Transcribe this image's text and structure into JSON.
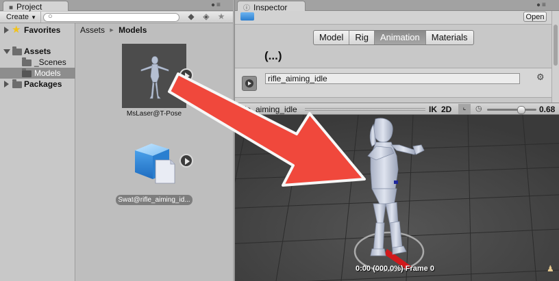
{
  "project": {
    "tab_label": "Project",
    "toolbar": {
      "create_label": "Create"
    },
    "tree": {
      "favorites": "Favorites",
      "assets": "Assets",
      "scenes": "_Scenes",
      "models": "Models",
      "packages": "Packages"
    },
    "breadcrumb": {
      "root": "Assets",
      "separator": "▶",
      "current": "Models"
    },
    "files": [
      {
        "label": "MsLaser@T-Pose"
      },
      {
        "label": "Swat@rifle_aiming_id..."
      }
    ]
  },
  "inspector": {
    "tab_label": "Inspector",
    "open_label": "Open",
    "tabs": [
      "Model",
      "Rig",
      "Animation",
      "Materials"
    ],
    "active_tab": "Animation",
    "ellipsis": "(...)",
    "clip_name": "rifle_aiming_idle"
  },
  "preview": {
    "clip_label": "rifle_aiming_idle",
    "ik_label": "IK",
    "mode_2d_label": "2D",
    "speed_value": "0.68",
    "speed_fraction": 0.68,
    "timecode": "0:00 (000.0%) Frame 0"
  },
  "colors": {
    "highlight_arrow": "#f0483c",
    "selection_bg": "#8d8d8d",
    "viewport_bg": "#4a4a4a"
  }
}
